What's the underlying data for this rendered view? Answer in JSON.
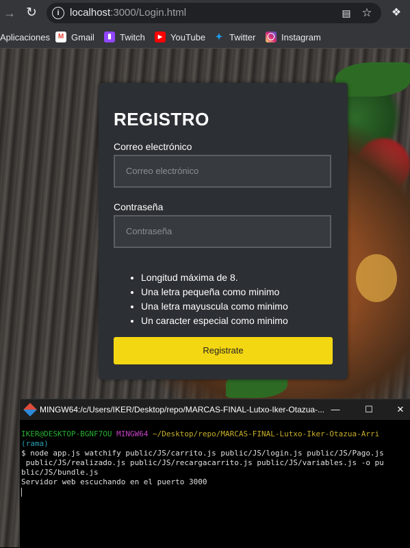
{
  "browser": {
    "url_host": "localhost",
    "url_rest": ":3000/Login.html",
    "bookmarks": [
      {
        "label": "Aplicaciones",
        "icon": "apps-icon"
      },
      {
        "label": "Gmail",
        "icon": "gmail-icon",
        "color": "#ea4335"
      },
      {
        "label": "Twitch",
        "icon": "twitch-icon",
        "color": "#9146ff"
      },
      {
        "label": "YouTube",
        "icon": "youtube-icon",
        "color": "#ff0000"
      },
      {
        "label": "Twitter",
        "icon": "twitter-icon",
        "color": "#1d9bf0"
      },
      {
        "label": "Instagram",
        "icon": "instagram-icon",
        "color": "#d62976"
      }
    ]
  },
  "form": {
    "title": "REGISTRO",
    "email_label": "Correo electrónico",
    "email_placeholder": "Correo electrónico",
    "password_label": "Contraseña",
    "password_placeholder": "Contraseña",
    "rules": [
      "Longitud máxima de 8.",
      "Una letra pequeña como minimo",
      "Una letra mayuscula como minimo",
      "Un caracter especial como minimo"
    ],
    "submit_label": "Registrate",
    "accent_color": "#f4d713"
  },
  "terminal": {
    "title": "MINGW64:/c/Users/IKER/Desktop/repo/MARCAS-FINAL-Lutxo-Iker-Otazua-...",
    "prompt_user": "IKER@DESKTOP-BGNF7OU",
    "prompt_env": "MINGW64",
    "prompt_path": "~/Desktop/repo/MARCAS-FINAL-Lutxo-Iker-Otazua-Arri",
    "prompt_branch": "(rama)",
    "command_lines": [
      "$ node app.js watchify public/JS/carrito.js public/JS/login.js public/JS/Pago.js",
      " public/JS/realizado.js public/JS/recargacarrito.js public/JS/variables.js -o pu",
      "blic/JS/bundle.js"
    ],
    "output": "Servidor web escuchando en el puerto 3000"
  }
}
